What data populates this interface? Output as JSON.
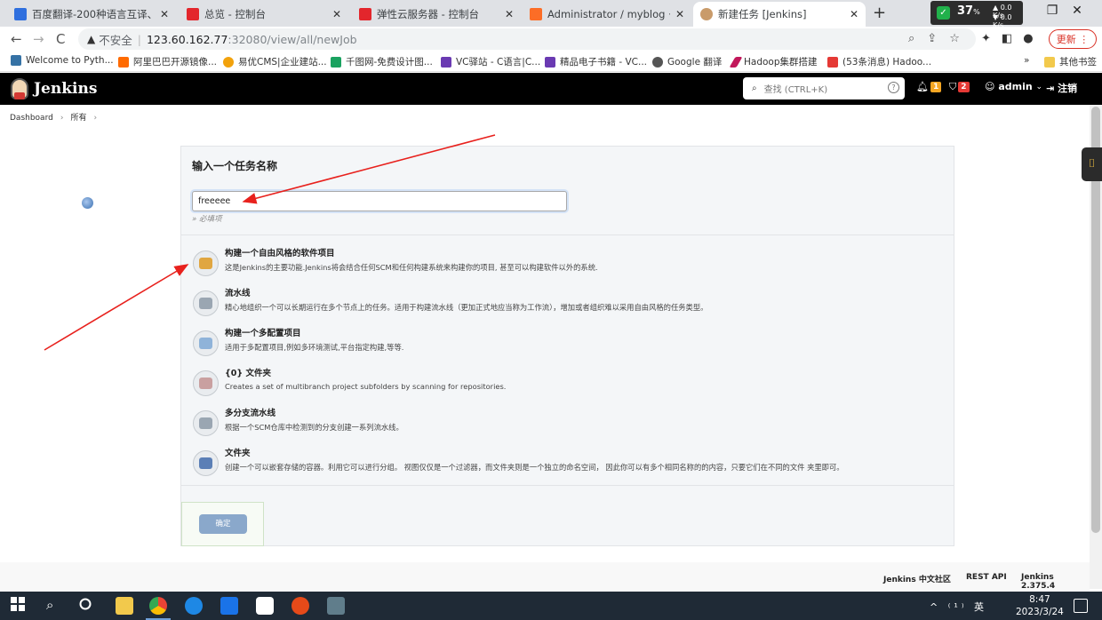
{
  "browser": {
    "tabs": [
      {
        "label": "百度翻译-200种语言互译、沟通",
        "color": "#2f6fde",
        "active": false
      },
      {
        "label": "总览 - 控制台",
        "color": "#e3262c",
        "active": false
      },
      {
        "label": "弹性云服务器 - 控制台",
        "color": "#e3262c",
        "active": false
      },
      {
        "label": "Administrator / myblog · GitLa",
        "color": "#fc6d26",
        "active": false
      },
      {
        "label": "新建任务 [Jenkins]",
        "color": "#c99b6a",
        "active": true
      }
    ],
    "newtab": "+",
    "net_widget": {
      "percent": "37",
      "pct_unit": "%",
      "up": "0.0 K/s",
      "down": "0.0 K/s"
    },
    "window_controls": {
      "minimize": "–",
      "restore": "❐",
      "close": "✕"
    },
    "nav": {
      "back": "←",
      "forward": "→",
      "reload": "C"
    },
    "address": {
      "warn": "▲",
      "insecure": "不安全",
      "separator": "|",
      "host": "123.60.162.77",
      "path": ":32080/view/all/newJob"
    },
    "update_label": "更新",
    "bookmarks": [
      {
        "label": "Welcome to Pyth...",
        "color": "#3572a5"
      },
      {
        "label": "阿里巴巴开源镜像...",
        "color": "#ff6a00"
      },
      {
        "label": "易优CMS|企业建站...",
        "color": "#f2a20c"
      },
      {
        "label": "千图网-免费设计图...",
        "color": "#1aa260"
      },
      {
        "label": "VC驿站 - C语言|C...",
        "color": "#6a3ab2"
      },
      {
        "label": "精品电子书籍 - VC...",
        "color": "#6a3ab2"
      },
      {
        "label": "Google 翻译",
        "color": "#555555"
      },
      {
        "label": "Hadoop集群搭建",
        "color": "#c2185b"
      },
      {
        "label": "(53条消息) Hadoo...",
        "color": "#e53935"
      }
    ],
    "bookmarks_more": "»",
    "other_bookmarks": "其他书签"
  },
  "jenkins": {
    "title": "Jenkins",
    "search_placeholder": "查找 (CTRL+K)",
    "search_help": "?",
    "notifications_count": "1",
    "security_count": "2",
    "user": "admin",
    "logout": "注销",
    "breadcrumb": [
      "Dashboard",
      "所有"
    ],
    "form": {
      "title": "输入一个任务名称",
      "name_value": "freeeee",
      "required_hint": "» 必填项"
    },
    "job_types": [
      {
        "name": "构建一个自由风格的软件项目",
        "desc": "这是Jenkins的主要功能.Jenkins将会结合任何SCM和任何构建系统来构建你的项目, 甚至可以构建软件以外的系统.",
        "color": "#e0a640"
      },
      {
        "name": "流水线",
        "desc": "精心地组织一个可以长期运行在多个节点上的任务。适用于构建流水线（更加正式地应当称为工作流），增加或者组织难以采用自由风格的任务类型。",
        "color": "#9aa6b2"
      },
      {
        "name": "构建一个多配置项目",
        "desc": "适用于多配置项目,例如多环境测试,平台指定构建,等等.",
        "color": "#8fb3d9"
      },
      {
        "name": "{0} 文件夹",
        "desc": "Creates a set of multibranch project subfolders by scanning for repositories.",
        "color": "#c9a0a0"
      },
      {
        "name": "多分支流水线",
        "desc": "根据一个SCM仓库中检测到的分支创建一系列流水线。",
        "color": "#9aa6b2"
      },
      {
        "name": "文件夹",
        "desc": "创建一个可以嵌套存储的容器。利用它可以进行分组。 视图仅仅是一个过滤器，而文件夹则是一个独立的命名空间， 因此你可以有多个相同名称的的内容，只要它们在不同的文件 夹里即可。",
        "color": "#5b7fb6"
      }
    ],
    "ok_button": "确定",
    "footer": {
      "community": "Jenkins 中文社区",
      "rest_api": "REST API",
      "version": "Jenkins 2.375.4"
    }
  },
  "taskbar": {
    "tray": "^ ⁽¹⁾ 英",
    "time": "8:47",
    "date": "2023/3/24",
    "notifications": "1"
  },
  "annotation_color": "#e8211d"
}
